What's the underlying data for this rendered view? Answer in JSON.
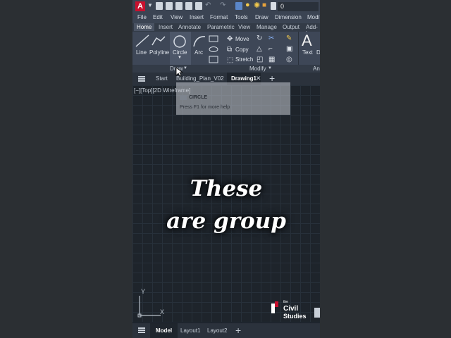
{
  "qat": {
    "logo": "A",
    "layer_value": "0"
  },
  "menu": [
    "File",
    "Edit",
    "View",
    "Insert",
    "Format",
    "Tools",
    "Draw",
    "Dimension",
    "Modif"
  ],
  "ribbon_tabs": [
    "Home",
    "Insert",
    "Annotate",
    "Parametric",
    "View",
    "Manage",
    "Output",
    "Add-in"
  ],
  "draw_tools": {
    "line": "Line",
    "polyline": "Polyline",
    "circle": "Circle",
    "arc": "Arc"
  },
  "modify_tools": {
    "move": "Move",
    "copy": "Copy",
    "stretch": "Stretch"
  },
  "annotation_tools": {
    "text": "Text",
    "text_glyph": "A",
    "cut": "D"
  },
  "panels": {
    "draw": "Draw",
    "modify": "Modify",
    "annotation": "Anr"
  },
  "file_tabs": {
    "start": "Start",
    "building": "Building_Plan_V02",
    "drawing": "Drawing1",
    "add": "+"
  },
  "viewport_label": "[−][Top][2D Wireframe]",
  "tooltip": {
    "command": "CIRCLE",
    "help": "Press F1 for more help"
  },
  "caption": {
    "line1": "These",
    "line2": "are group"
  },
  "ucs": {
    "y": "Y",
    "x": "X"
  },
  "brand": {
    "the": "the",
    "civil": "Civil",
    "studies": "Studies"
  },
  "layout_tabs": {
    "model": "Model",
    "layout1": "Layout1",
    "layout2": "Layout2",
    "add": "+"
  },
  "colors": {
    "accent": "#c8102e",
    "bg": "#1f252d",
    "ribbon": "#3e4757"
  }
}
